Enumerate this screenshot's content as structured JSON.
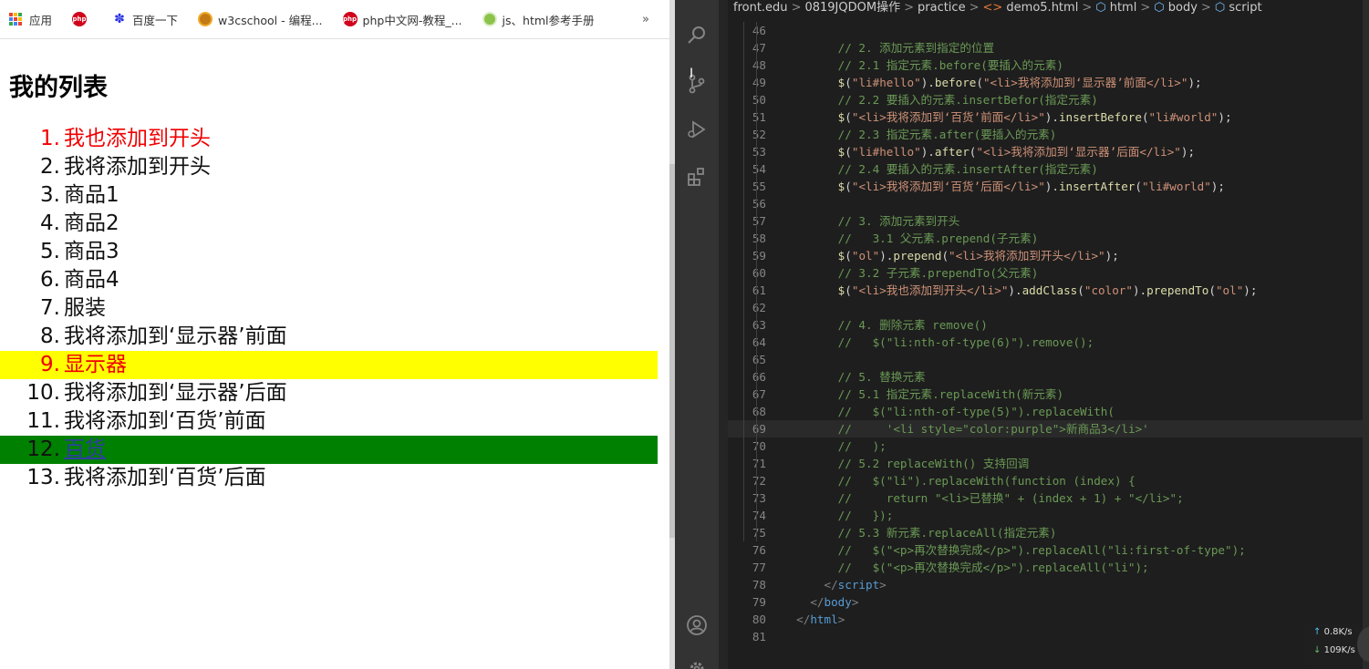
{
  "bookmarks": {
    "apps": "应用",
    "items": [
      {
        "label": "",
        "icon": "php-icon"
      },
      {
        "label": "百度一下",
        "icon": "baidu-paw-icon"
      },
      {
        "label": "w3cschool - 编程...",
        "icon": "w3cschool-icon"
      },
      {
        "label": "php中文网-教程_...",
        "icon": "php-icon"
      },
      {
        "label": "js、html参考手册",
        "icon": "js-manual-icon"
      }
    ],
    "more": "»"
  },
  "page": {
    "title": "我的列表",
    "list": [
      {
        "num": "1.",
        "text": "我也添加到开头",
        "style": "red"
      },
      {
        "num": "2.",
        "text": "我将添加到开头",
        "style": ""
      },
      {
        "num": "3.",
        "text": "商品1",
        "style": ""
      },
      {
        "num": "4.",
        "text": "商品2",
        "style": ""
      },
      {
        "num": "5.",
        "text": "商品3",
        "style": ""
      },
      {
        "num": "6.",
        "text": "商品4",
        "style": ""
      },
      {
        "num": "7.",
        "text": "服装",
        "style": ""
      },
      {
        "num": "8.",
        "text": "我将添加到‘显示器’前面",
        "style": ""
      },
      {
        "num": "9.",
        "text": "显示器",
        "style": "hl-yellow"
      },
      {
        "num": "10.",
        "text": "我将添加到‘显示器’后面",
        "style": ""
      },
      {
        "num": "11.",
        "text": "我将添加到‘百货’前面",
        "style": ""
      },
      {
        "num": "12.",
        "text": "百货",
        "style": "hl-green"
      },
      {
        "num": "13.",
        "text": "我将添加到‘百货’后面",
        "style": ""
      }
    ]
  },
  "editor": {
    "breadcrumb": [
      "front.edu",
      "0819JQDOM操作",
      "practice",
      "demo5.html",
      "html",
      "body",
      "script"
    ],
    "current_line": 69,
    "lines": [
      {
        "n": "46",
        "t": []
      },
      {
        "n": "47",
        "t": [
          [
            "",
            "        "
          ],
          [
            "c-cm",
            "// 2. 添加元素到指定的位置"
          ]
        ]
      },
      {
        "n": "48",
        "t": [
          [
            "",
            "        "
          ],
          [
            "c-cm",
            "// 2.1 指定元素.before(要插入的元素)"
          ]
        ]
      },
      {
        "n": "49",
        "t": [
          [
            "",
            "        "
          ],
          [
            "c-fn",
            "$"
          ],
          [
            "c-def",
            "("
          ],
          [
            "c-str",
            "\"li#hello\""
          ],
          [
            "c-def",
            ")."
          ],
          [
            "c-fn",
            "before"
          ],
          [
            "c-def",
            "("
          ],
          [
            "c-str",
            "\"<li>我将添加到‘显示器’前面</li>\""
          ],
          [
            "c-def",
            ");"
          ]
        ]
      },
      {
        "n": "50",
        "t": [
          [
            "",
            "        "
          ],
          [
            "c-cm",
            "// 2.2 要插入的元素.insertBefor(指定元素)"
          ]
        ]
      },
      {
        "n": "51",
        "t": [
          [
            "",
            "        "
          ],
          [
            "c-fn",
            "$"
          ],
          [
            "c-def",
            "("
          ],
          [
            "c-str",
            "\"<li>我将添加到‘百货’前面</li>\""
          ],
          [
            "c-def",
            ")."
          ],
          [
            "c-fn",
            "insertBefore"
          ],
          [
            "c-def",
            "("
          ],
          [
            "c-str",
            "\"li#world\""
          ],
          [
            "c-def",
            ");"
          ]
        ]
      },
      {
        "n": "52",
        "t": [
          [
            "",
            "        "
          ],
          [
            "c-cm",
            "// 2.3 指定元素.after(要插入的元素)"
          ]
        ]
      },
      {
        "n": "53",
        "t": [
          [
            "",
            "        "
          ],
          [
            "c-fn",
            "$"
          ],
          [
            "c-def",
            "("
          ],
          [
            "c-str",
            "\"li#hello\""
          ],
          [
            "c-def",
            ")."
          ],
          [
            "c-fn",
            "after"
          ],
          [
            "c-def",
            "("
          ],
          [
            "c-str",
            "\"<li>我将添加到‘显示器’后面</li>\""
          ],
          [
            "c-def",
            ");"
          ]
        ]
      },
      {
        "n": "54",
        "t": [
          [
            "",
            "        "
          ],
          [
            "c-cm",
            "// 2.4 要插入的元素.insertAfter(指定元素)"
          ]
        ]
      },
      {
        "n": "55",
        "t": [
          [
            "",
            "        "
          ],
          [
            "c-fn",
            "$"
          ],
          [
            "c-def",
            "("
          ],
          [
            "c-str",
            "\"<li>我将添加到‘百货’后面</li>\""
          ],
          [
            "c-def",
            ")."
          ],
          [
            "c-fn",
            "insertAfter"
          ],
          [
            "c-def",
            "("
          ],
          [
            "c-str",
            "\"li#world\""
          ],
          [
            "c-def",
            ");"
          ]
        ]
      },
      {
        "n": "56",
        "t": []
      },
      {
        "n": "57",
        "t": [
          [
            "",
            "        "
          ],
          [
            "c-cm",
            "// 3. 添加元素到开头"
          ]
        ]
      },
      {
        "n": "58",
        "t": [
          [
            "",
            "        "
          ],
          [
            "c-cm",
            "//   3.1 父元素.prepend(子元素)"
          ]
        ]
      },
      {
        "n": "59",
        "t": [
          [
            "",
            "        "
          ],
          [
            "c-fn",
            "$"
          ],
          [
            "c-def",
            "("
          ],
          [
            "c-str",
            "\"ol\""
          ],
          [
            "c-def",
            ")."
          ],
          [
            "c-fn",
            "prepend"
          ],
          [
            "c-def",
            "("
          ],
          [
            "c-str",
            "\"<li>我将添加到开头</li>\""
          ],
          [
            "c-def",
            ");"
          ]
        ]
      },
      {
        "n": "60",
        "t": [
          [
            "",
            "        "
          ],
          [
            "c-cm",
            "// 3.2 子元素.prependTo(父元素)"
          ]
        ]
      },
      {
        "n": "61",
        "t": [
          [
            "",
            "        "
          ],
          [
            "c-fn",
            "$"
          ],
          [
            "c-def",
            "("
          ],
          [
            "c-str",
            "\"<li>我也添加到开头</li>\""
          ],
          [
            "c-def",
            ")."
          ],
          [
            "c-fn",
            "addClass"
          ],
          [
            "c-def",
            "("
          ],
          [
            "c-str",
            "\"color\""
          ],
          [
            "c-def",
            ")."
          ],
          [
            "c-fn",
            "prependTo"
          ],
          [
            "c-def",
            "("
          ],
          [
            "c-str",
            "\"ol\""
          ],
          [
            "c-def",
            ");"
          ]
        ]
      },
      {
        "n": "62",
        "t": []
      },
      {
        "n": "63",
        "t": [
          [
            "",
            "        "
          ],
          [
            "c-cm",
            "// 4. 删除元素 remove()"
          ]
        ]
      },
      {
        "n": "64",
        "t": [
          [
            "",
            "        "
          ],
          [
            "c-cm",
            "//   $(\"li:nth-of-type(6)\").remove();"
          ]
        ]
      },
      {
        "n": "65",
        "t": []
      },
      {
        "n": "66",
        "t": [
          [
            "",
            "        "
          ],
          [
            "c-cm",
            "// 5. 替换元素"
          ]
        ]
      },
      {
        "n": "67",
        "t": [
          [
            "",
            "        "
          ],
          [
            "c-cm",
            "// 5.1 指定元素.replaceWith(新元素)"
          ]
        ]
      },
      {
        "n": "68",
        "t": [
          [
            "",
            "        "
          ],
          [
            "c-cm",
            "//   $(\"li:nth-of-type(5)\").replaceWith("
          ]
        ]
      },
      {
        "n": "69",
        "t": [
          [
            "",
            "        "
          ],
          [
            "c-cm",
            "//     '<li style=\"color:purple\">新商品3</li>'"
          ]
        ]
      },
      {
        "n": "70",
        "t": [
          [
            "",
            "        "
          ],
          [
            "c-cm",
            "//   );"
          ]
        ]
      },
      {
        "n": "71",
        "t": [
          [
            "",
            "        "
          ],
          [
            "c-cm",
            "// 5.2 replaceWith() 支持回调"
          ]
        ]
      },
      {
        "n": "72",
        "t": [
          [
            "",
            "        "
          ],
          [
            "c-cm",
            "//   $(\"li\").replaceWith(function (index) {"
          ]
        ]
      },
      {
        "n": "73",
        "t": [
          [
            "",
            "        "
          ],
          [
            "c-cm",
            "//     return \"<li>已替换\" + (index + 1) + \"</li>\";"
          ]
        ]
      },
      {
        "n": "74",
        "t": [
          [
            "",
            "        "
          ],
          [
            "c-cm",
            "//   });"
          ]
        ]
      },
      {
        "n": "75",
        "t": [
          [
            "",
            "        "
          ],
          [
            "c-cm",
            "// 5.3 新元素.replaceAll(指定元素)"
          ]
        ]
      },
      {
        "n": "76",
        "t": [
          [
            "",
            "        "
          ],
          [
            "c-cm",
            "//   $(\"<p>再次替换完成</p>\").replaceAll(\"li:first-of-type\");"
          ]
        ]
      },
      {
        "n": "77",
        "t": [
          [
            "",
            "        "
          ],
          [
            "c-cm",
            "//   $(\"<p>再次替换完成</p>\").replaceAll(\"li\");"
          ]
        ]
      },
      {
        "n": "78",
        "t": [
          [
            "",
            "      "
          ],
          [
            "c-pun",
            "</"
          ],
          [
            "c-tag",
            "script"
          ],
          [
            "c-pun",
            ">"
          ]
        ]
      },
      {
        "n": "79",
        "t": [
          [
            "",
            "    "
          ],
          [
            "c-pun",
            "</"
          ],
          [
            "c-tag",
            "body"
          ],
          [
            "c-pun",
            ">"
          ]
        ]
      },
      {
        "n": "80",
        "t": [
          [
            "",
            "  "
          ],
          [
            "c-pun",
            "</"
          ],
          [
            "c-tag",
            "html"
          ],
          [
            "c-pun",
            ">"
          ]
        ]
      },
      {
        "n": "81",
        "t": []
      }
    ]
  },
  "network": {
    "up": "0.8K/s",
    "down": "109K/s"
  }
}
